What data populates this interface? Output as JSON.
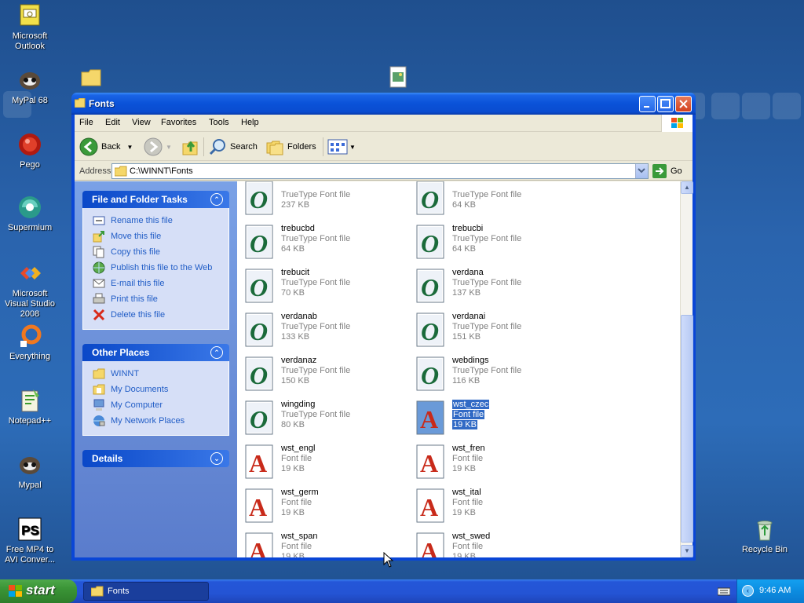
{
  "desktop": {
    "icons": [
      {
        "label": "Microsoft Outlook"
      },
      {
        "label": "MyPal 68"
      },
      {
        "label": "Pego"
      },
      {
        "label": "Supermium"
      },
      {
        "label": "Microsoft Visual Studio 2008"
      },
      {
        "label": "Everything"
      },
      {
        "label": "Notepad++"
      },
      {
        "label": "Mypal"
      },
      {
        "label": "Free MP4 to AVI Conver..."
      },
      {
        "label": "Recycle Bin"
      }
    ]
  },
  "window": {
    "title": "Fonts",
    "menu": [
      "File",
      "Edit",
      "View",
      "Favorites",
      "Tools",
      "Help"
    ],
    "toolbar": {
      "back": "Back",
      "search": "Search",
      "folders": "Folders"
    },
    "address": {
      "label": "Address",
      "path": "C:\\WINNT\\Fonts",
      "go": "Go"
    },
    "tasks": {
      "file_folder": {
        "title": "File and Folder Tasks",
        "items": [
          "Rename this file",
          "Move this file",
          "Copy this file",
          "Publish this file to the Web",
          "E-mail this file",
          "Print this file",
          "Delete this file"
        ]
      },
      "other_places": {
        "title": "Other Places",
        "items": [
          "WINNT",
          "My Documents",
          "My Computer",
          "My Network Places"
        ]
      },
      "details": {
        "title": "Details"
      }
    },
    "files": [
      {
        "name": "",
        "type": "TrueType Font file",
        "size": "237 KB",
        "kind": "tt"
      },
      {
        "name": "",
        "type": "TrueType Font file",
        "size": "64 KB",
        "kind": "tt"
      },
      {
        "name": "trebucbd",
        "type": "TrueType Font file",
        "size": "64 KB",
        "kind": "tt"
      },
      {
        "name": "trebucbi",
        "type": "TrueType Font file",
        "size": "64 KB",
        "kind": "tt"
      },
      {
        "name": "trebucit",
        "type": "TrueType Font file",
        "size": "70 KB",
        "kind": "tt"
      },
      {
        "name": "verdana",
        "type": "TrueType Font file",
        "size": "137 KB",
        "kind": "tt"
      },
      {
        "name": "verdanab",
        "type": "TrueType Font file",
        "size": "133 KB",
        "kind": "tt"
      },
      {
        "name": "verdanai",
        "type": "TrueType Font file",
        "size": "151 KB",
        "kind": "tt"
      },
      {
        "name": "verdanaz",
        "type": "TrueType Font file",
        "size": "150 KB",
        "kind": "tt"
      },
      {
        "name": "webdings",
        "type": "TrueType Font file",
        "size": "116 KB",
        "kind": "tt"
      },
      {
        "name": "wingding",
        "type": "TrueType Font file",
        "size": "80 KB",
        "kind": "tt"
      },
      {
        "name": "wst_czec",
        "type": "Font file",
        "size": "19 KB",
        "kind": "font",
        "selected": true
      },
      {
        "name": "wst_engl",
        "type": "Font file",
        "size": "19 KB",
        "kind": "font"
      },
      {
        "name": "wst_fren",
        "type": "Font file",
        "size": "19 KB",
        "kind": "font"
      },
      {
        "name": "wst_germ",
        "type": "Font file",
        "size": "19 KB",
        "kind": "font"
      },
      {
        "name": "wst_ital",
        "type": "Font file",
        "size": "19 KB",
        "kind": "font"
      },
      {
        "name": "wst_span",
        "type": "Font file",
        "size": "19 KB",
        "kind": "font"
      },
      {
        "name": "wst_swed",
        "type": "Font file",
        "size": "19 KB",
        "kind": "font"
      }
    ]
  },
  "taskbar": {
    "start": "start",
    "task_button": "Fonts",
    "clock": "9:46 AM"
  }
}
